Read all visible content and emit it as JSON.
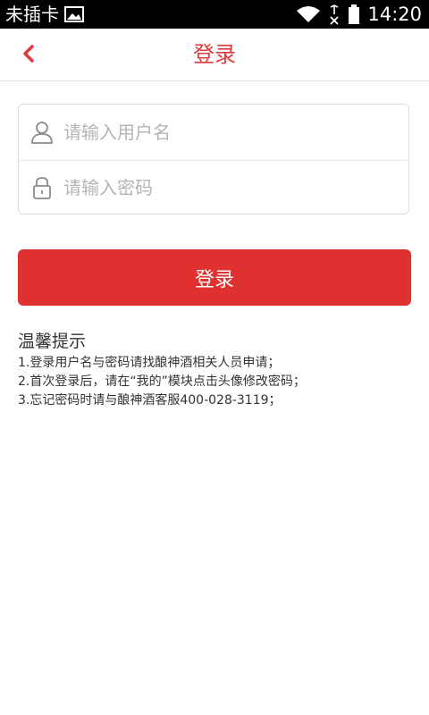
{
  "status_bar": {
    "carrier": "未插卡",
    "time": "14:20",
    "icons": [
      "image-icon",
      "wifi-icon",
      "no-sim-icon",
      "battery-icon"
    ]
  },
  "header": {
    "title": "登录",
    "back_icon": "chevron-left-icon"
  },
  "form": {
    "username_placeholder": "请输入用户名",
    "password_placeholder": "请输入密码",
    "username_icon": "user-icon",
    "password_icon": "lock-icon"
  },
  "login_button": {
    "label": "登录"
  },
  "tips": {
    "title": "温馨提示",
    "lines": [
      "1.登录用户名与密码请找酿神酒相关人员申请；",
      "2.首次登录后，请在“我的”模块点击头像修改密码；",
      "3.忘记密码时请与酿神酒客服400-028-3119；"
    ]
  },
  "colors": {
    "accent": "#e03131",
    "title": "#e03a3a",
    "statusbar_bg": "#000000"
  }
}
